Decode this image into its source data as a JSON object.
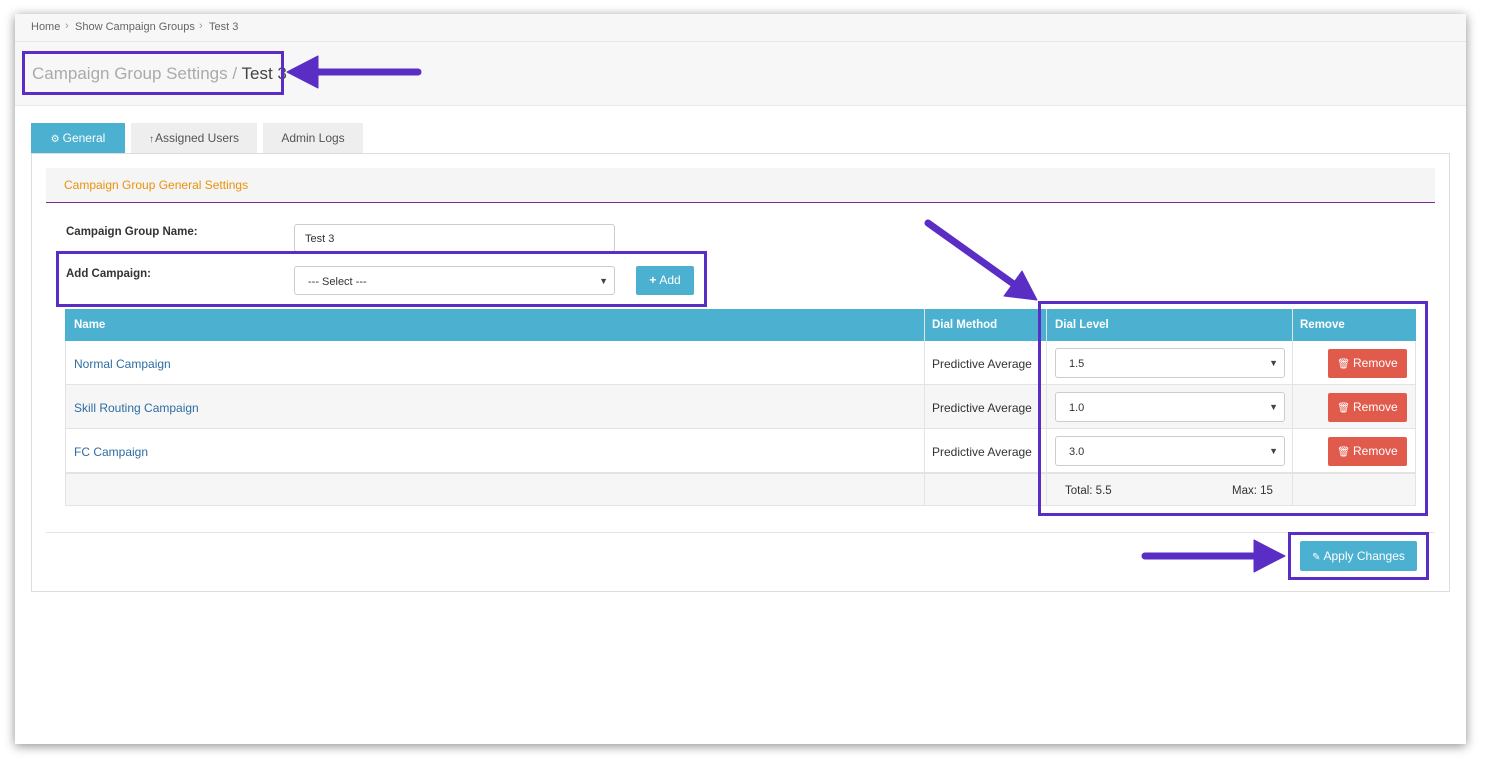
{
  "breadcrumb": [
    "Home",
    "Show Campaign Groups",
    "Test 3"
  ],
  "breadcrumb_separator": "›",
  "page": {
    "title_prefix": "Campaign Group Settings / ",
    "title_current": "Test 3"
  },
  "tabs": [
    {
      "label": "General",
      "icon": "gears-icon",
      "active": true
    },
    {
      "label": "Assigned Users",
      "icon": "arrow-up-icon",
      "active": false
    },
    {
      "label": "Admin Logs",
      "active": false
    }
  ],
  "section": {
    "title": "Campaign Group General Settings"
  },
  "form": {
    "name_label": "Campaign Group Name:",
    "name_value": "Test 3",
    "add_label": "Add Campaign:",
    "add_select_value": "--- Select ---",
    "add_button": "Add"
  },
  "table": {
    "headers": [
      "Name",
      "Dial Method",
      "Dial Level",
      "Remove"
    ],
    "rows": [
      {
        "name": "Normal Campaign",
        "method": "Predictive Average",
        "dial_level": "1.5",
        "remove": "Remove"
      },
      {
        "name": "Skill Routing Campaign",
        "method": "Predictive Average",
        "dial_level": "1.0",
        "remove": "Remove"
      },
      {
        "name": "FC Campaign",
        "method": "Predictive Average",
        "dial_level": "3.0",
        "remove": "Remove"
      }
    ],
    "total": "Total: 5.5",
    "max": "Max: 15"
  },
  "apply_button": "Apply Changes",
  "colors": {
    "accent": "#4cb1d0",
    "danger": "#e15b4d",
    "section_title": "#e8930b",
    "annotation": "#5a2ec4",
    "link": "#2e6da4"
  }
}
